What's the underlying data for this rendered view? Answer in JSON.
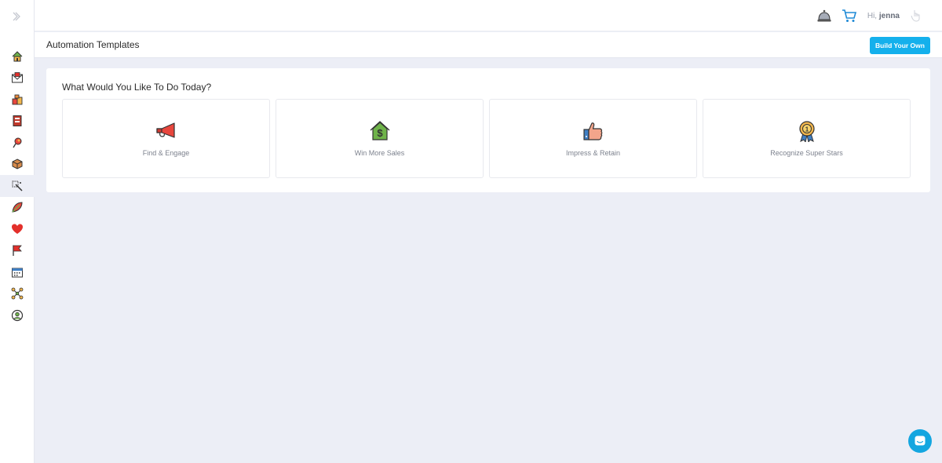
{
  "header": {
    "greeting_prefix": "Hi,",
    "user_name": "jenna"
  },
  "titlebar": {
    "title": "Automation Templates",
    "build_label": "Build Your Own"
  },
  "panel": {
    "heading": "What Would You Like To Do Today?",
    "cards": [
      {
        "label": "Find & Engage",
        "icon": "megaphone-icon"
      },
      {
        "label": "Win More Sales",
        "icon": "house-dollar-icon"
      },
      {
        "label": "Impress & Retain",
        "icon": "thumbs-up-icon"
      },
      {
        "label": "Recognize Super Stars",
        "icon": "award-ribbon-icon"
      }
    ]
  },
  "sidebar": {
    "items": [
      "home-icon",
      "mail-icon",
      "boxes-icon",
      "book-icon",
      "pushpin-icon",
      "package-icon",
      "magic-wand-icon",
      "leaf-icon",
      "heart-icon",
      "flag-icon",
      "calendar-icon",
      "network-icon",
      "user-circle-icon"
    ],
    "active_index": 6
  },
  "colors": {
    "accent": "#14b0ec",
    "background": "#eceef6",
    "megaphone": "#e8463d",
    "house": "#6fb34a",
    "heart": "#e3302b"
  }
}
